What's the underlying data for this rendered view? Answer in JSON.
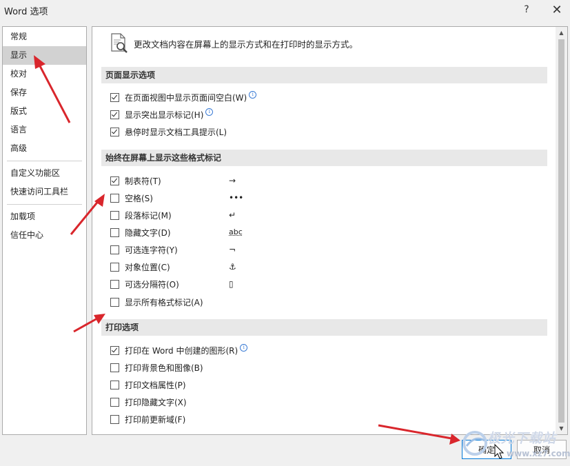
{
  "window": {
    "title": "Word 选项",
    "help_label": "?",
    "close_label": "✕"
  },
  "sidebar": {
    "items": [
      {
        "label": "常规"
      },
      {
        "label": "显示"
      },
      {
        "label": "校对"
      },
      {
        "label": "保存"
      },
      {
        "label": "版式"
      },
      {
        "label": "语言"
      },
      {
        "label": "高级"
      },
      {
        "label": "自定义功能区"
      },
      {
        "label": "快速访问工具栏"
      },
      {
        "label": "加载项"
      },
      {
        "label": "信任中心"
      }
    ],
    "active_index": 1
  },
  "intro": {
    "text": "更改文档内容在屏幕上的显示方式和在打印时的显示方式。",
    "icon": "document-magnifier-icon"
  },
  "sections": {
    "page_display": {
      "header": "页面显示选项",
      "options": [
        {
          "label": "在页面视图中显示页面间空白(W)",
          "checked": true,
          "info": true
        },
        {
          "label": "显示突出显示标记(H)",
          "checked": true,
          "info": true
        },
        {
          "label": "悬停时显示文档工具提示(L)",
          "checked": true,
          "info": false
        }
      ]
    },
    "format_marks": {
      "header": "始终在屏幕上显示这些格式标记",
      "options": [
        {
          "label": "制表符(T)",
          "checked": true,
          "symbol": "→"
        },
        {
          "label": "空格(S)",
          "checked": false,
          "symbol": "•••"
        },
        {
          "label": "段落标记(M)",
          "checked": false,
          "symbol": "↵"
        },
        {
          "label": "隐藏文字(D)",
          "checked": false,
          "symbol": "abc"
        },
        {
          "label": "可选连字符(Y)",
          "checked": false,
          "symbol": "¬"
        },
        {
          "label": "对象位置(C)",
          "checked": false,
          "symbol": "⚓"
        },
        {
          "label": "可选分隔符(O)",
          "checked": false,
          "symbol": "▯"
        },
        {
          "label": "显示所有格式标记(A)",
          "checked": false,
          "symbol": ""
        }
      ]
    },
    "print": {
      "header": "打印选项",
      "options": [
        {
          "label": "打印在 Word 中创建的图形(R)",
          "checked": true,
          "info": true
        },
        {
          "label": "打印背景色和图像(B)",
          "checked": false,
          "info": false
        },
        {
          "label": "打印文档属性(P)",
          "checked": false,
          "info": false
        },
        {
          "label": "打印隐藏文字(X)",
          "checked": false,
          "info": false
        },
        {
          "label": "打印前更新域(F)",
          "checked": false,
          "info": false
        }
      ]
    }
  },
  "footer": {
    "ok_label": "确定",
    "cancel_label": "取消"
  },
  "watermark": {
    "line1": "极光下载站",
    "line2": "www.xz7.com"
  },
  "colors": {
    "annotation_arrow": "#d9262c",
    "active_nav_bg": "#d2d2d2",
    "section_header_bg": "#e8e8e8"
  }
}
